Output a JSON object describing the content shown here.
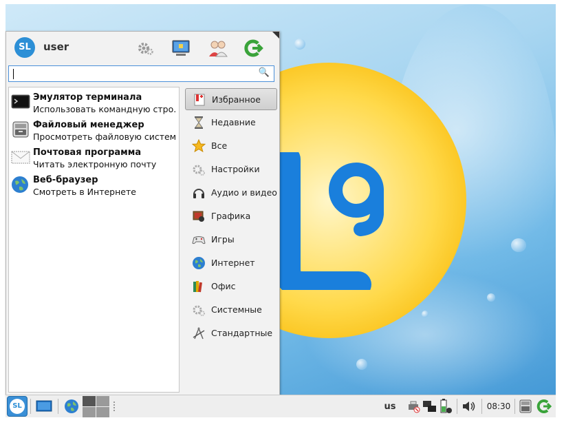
{
  "user": {
    "avatar_text": "SL",
    "name": "user"
  },
  "header_icons": [
    "gear-icon",
    "monitor-lock-icon",
    "users-icon",
    "logout-arrow-icon"
  ],
  "search": {
    "value": "",
    "icon": "search-icon"
  },
  "apps": [
    {
      "name": "Эмулятор терминала",
      "desc": "Использовать командную стро...",
      "icon": "terminal-icon"
    },
    {
      "name": "Файловый менеджер",
      "desc": "Просмотреть файловую систему",
      "icon": "file-manager-icon"
    },
    {
      "name": "Почтовая программа",
      "desc": "Читать электронную почту",
      "icon": "mail-icon"
    },
    {
      "name": "Веб-браузер",
      "desc": "Смотреть в Интернете",
      "icon": "globe-icon"
    }
  ],
  "categories": [
    {
      "label": "Избранное",
      "icon": "bookmark-icon",
      "selected": true
    },
    {
      "label": "Недавние",
      "icon": "hourglass-icon"
    },
    {
      "label": "Все",
      "icon": "star-icon"
    },
    {
      "label": "Настройки",
      "icon": "gear-icon"
    },
    {
      "label": "Аудио и видео",
      "icon": "headphones-icon"
    },
    {
      "label": "Графика",
      "icon": "graphics-icon"
    },
    {
      "label": "Игры",
      "icon": "gamepad-icon"
    },
    {
      "label": "Интернет",
      "icon": "globe-icon"
    },
    {
      "label": "Офис",
      "icon": "books-icon"
    },
    {
      "label": "Системные",
      "icon": "gear-icon"
    },
    {
      "label": "Стандартные",
      "icon": "compass-icon"
    }
  ],
  "taskbar": {
    "start_text": "SL",
    "keyboard_layout": "us",
    "clock": "08:30"
  },
  "wallpaper": {
    "logo_text": "L9"
  }
}
